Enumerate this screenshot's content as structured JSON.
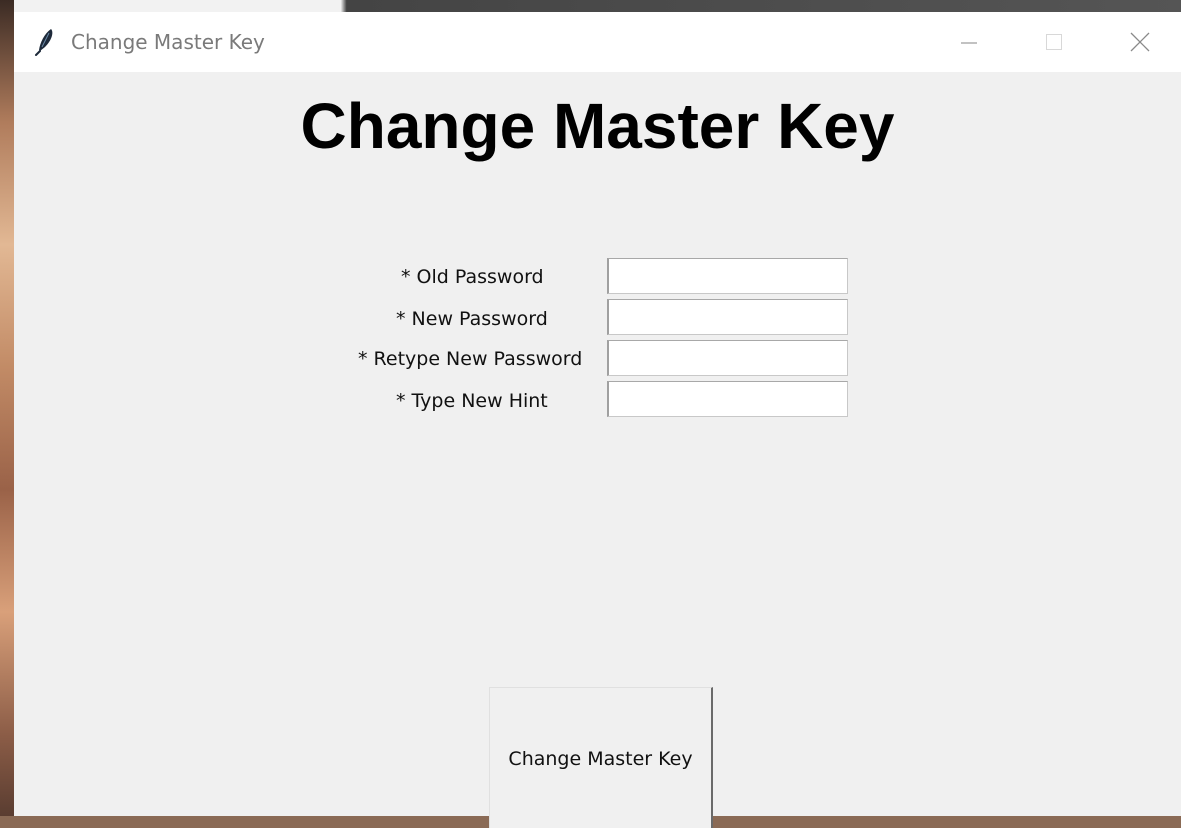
{
  "window": {
    "title": "Change Master Key",
    "controls": {
      "minimize_icon": "minimize-icon",
      "maximize_icon": "maximize-icon",
      "close_icon": "close-icon"
    }
  },
  "form": {
    "heading": "Change Master Key",
    "fields": [
      {
        "label": "* Old Password",
        "value": ""
      },
      {
        "label": "* New Password",
        "value": ""
      },
      {
        "label": "* Retype New Password",
        "value": ""
      },
      {
        "label": "* Type New Hint",
        "value": ""
      }
    ],
    "submit_label": "Change Master Key"
  },
  "colors": {
    "window_bg": "#f0f0f0",
    "titlebar_bg": "#ffffff",
    "title_text": "#7a7a7a"
  }
}
